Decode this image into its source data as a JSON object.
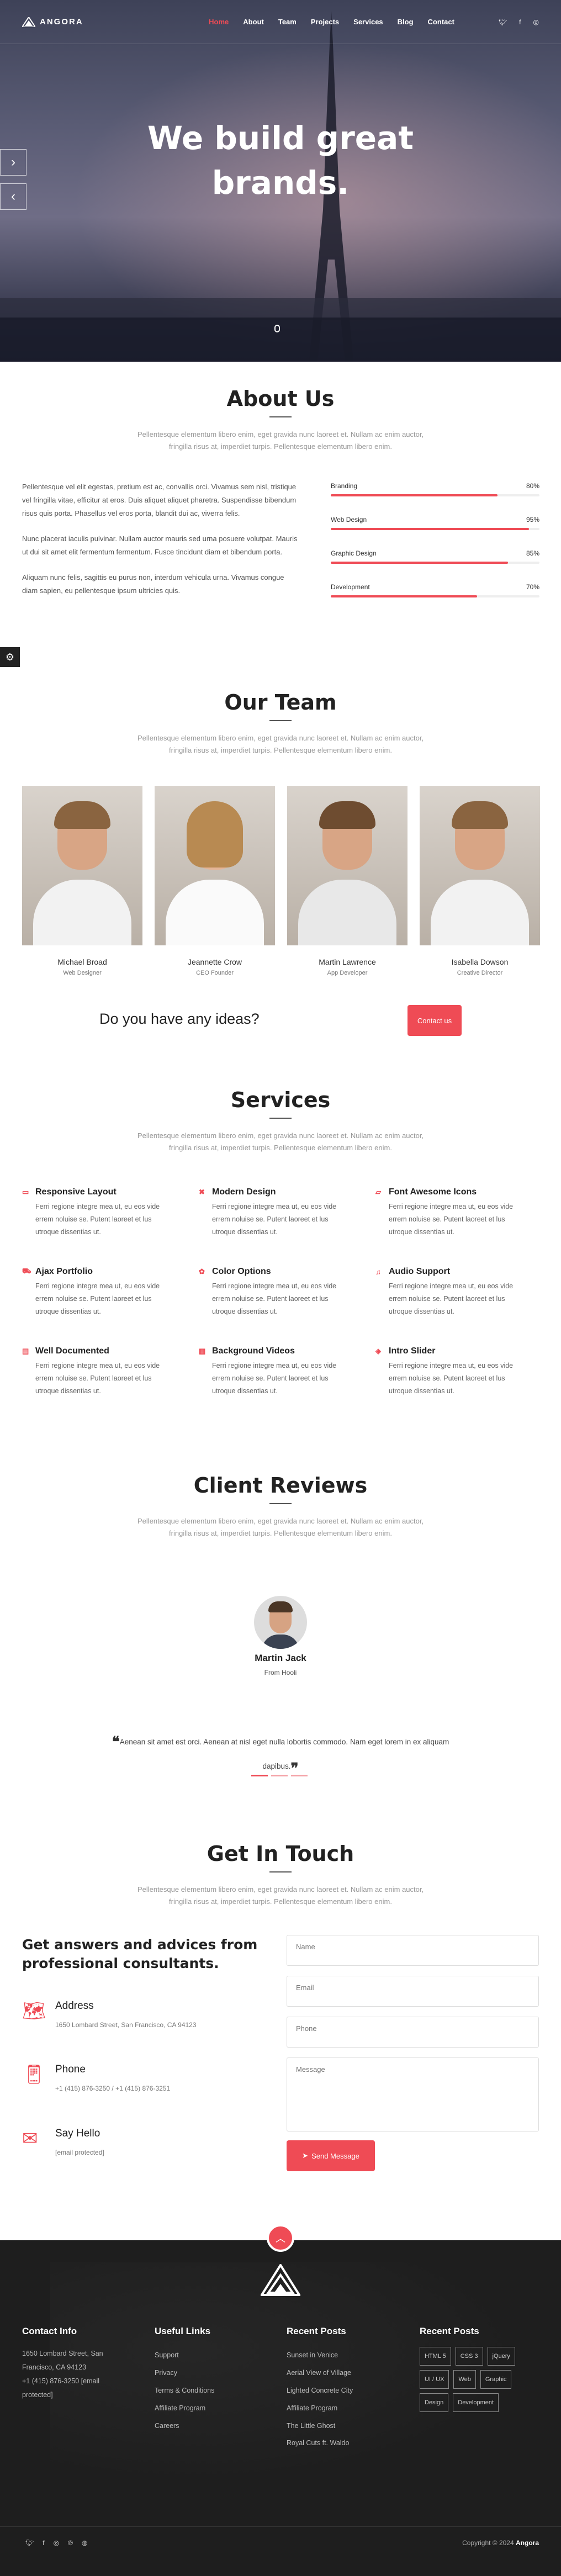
{
  "brand": {
    "name": "ANGORA"
  },
  "nav": {
    "items": [
      "Home",
      "About",
      "Team",
      "Projects",
      "Services",
      "Blog",
      "Contact"
    ],
    "active": "Home",
    "social": [
      "twitter-icon",
      "facebook-icon",
      "instagram-icon"
    ]
  },
  "hero": {
    "line1": "We build great",
    "line2": "brands."
  },
  "about": {
    "title": "About Us",
    "subtitle": "Pellentesque elementum libero enim, eget gravida nunc laoreet et. Nullam ac enim auctor, fringilla risus at, imperdiet turpis. Pellentesque elementum libero enim.",
    "p1": "Pellentesque vel elit egestas, pretium est ac, convallis orci. Vivamus sem nisl, tristique vel fringilla vitae, efficitur at eros. Duis aliquet aliquet pharetra. Suspendisse bibendum risus quis porta. Phasellus vel eros porta, blandit dui ac, viverra felis.",
    "p2": "Nunc placerat iaculis pulvinar. Nullam auctor mauris sed urna posuere volutpat. Mauris ut dui sit amet elit fermentum fermentum. Fusce tincidunt diam et bibendum porta.",
    "p3": "Aliquam nunc felis, sagittis eu purus non, interdum vehicula urna. Vivamus congue diam sapien, eu pellentesque ipsum ultricies quis.",
    "skills": [
      {
        "name": "Branding",
        "value": "80%",
        "level": 0.8
      },
      {
        "name": "Web Design",
        "value": "95%",
        "level": 0.95
      },
      {
        "name": "Graphic Design",
        "value": "85%",
        "level": 0.85
      },
      {
        "name": "Development",
        "value": "70%",
        "level": 0.7
      }
    ]
  },
  "team": {
    "title": "Our Team",
    "subtitle": "Pellentesque elementum libero enim, eget gravida nunc laoreet et. Nullam ac enim auctor, fringilla risus at, imperdiet turpis. Pellentesque elementum libero enim.",
    "members": [
      {
        "name": "Michael Broad",
        "role": "Web Designer"
      },
      {
        "name": "Jeannette Crow",
        "role": "CEO Founder"
      },
      {
        "name": "Martin Lawrence",
        "role": "App Developer"
      },
      {
        "name": "Isabella Dowson",
        "role": "Creative Director"
      }
    ]
  },
  "cta": {
    "text": "Do you have any ideas?",
    "button": "Contact us"
  },
  "services": {
    "title": "Services",
    "subtitle": "Pellentesque elementum libero enim, eget gravida nunc laoreet et. Nullam ac enim auctor, fringilla risus at, imperdiet turpis. Pellentesque elementum libero enim.",
    "description": "Ferri regione integre mea ut, eu eos vide errem noluise se. Putent laoreet et lus utroque dissentias ut.",
    "items": [
      {
        "title": "Responsive Layout",
        "icon": "laptop-icon"
      },
      {
        "title": "Modern Design",
        "icon": "cross-icon"
      },
      {
        "title": "Font Awesome Icons",
        "icon": "folder-icon"
      },
      {
        "title": "Ajax Portfolio",
        "icon": "car-icon"
      },
      {
        "title": "Color Options",
        "icon": "palette-icon"
      },
      {
        "title": "Audio Support",
        "icon": "headphones-icon"
      },
      {
        "title": "Well Documented",
        "icon": "book-icon"
      },
      {
        "title": "Background Videos",
        "icon": "film-icon"
      },
      {
        "title": "Intro Slider",
        "icon": "slider-icon"
      }
    ]
  },
  "reviews": {
    "title": "Client Reviews",
    "subtitle": "Pellentesque elementum libero enim, eget gravida nunc laoreet et. Nullam ac enim auctor, fringilla risus at, imperdiet turpis. Pellentesque elementum libero enim.",
    "name": "Martin Jack",
    "from": "From Hooli",
    "quote": "Aenean sit amet est orci. Aenean at nisl eget nulla lobortis commodo. Nam eget lorem in ex aliquam dapibus."
  },
  "contact": {
    "title": "Get In Touch",
    "subtitle": "Pellentesque elementum libero enim, eget gravida nunc laoreet et. Nullam ac enim auctor, fringilla risus at, imperdiet turpis. Pellentesque elementum libero enim.",
    "heading": "Get answers and advices from professional consultants.",
    "address_label": "Address",
    "address": "1650 Lombard Street, San Francisco, CA 94123",
    "phone_label": "Phone",
    "phone": "+1 (415) 876-3250 / +1 (415) 876-3251",
    "email_label": "Say Hello",
    "email": "[email protected]",
    "name_ph": "Name",
    "email_ph": "Email",
    "phone_ph": "Phone",
    "message_ph": "Message",
    "send": "Send Message"
  },
  "footer": {
    "info_title": "Contact Info",
    "info_address": "1650 Lombard Street, San Francisco, CA 94123",
    "info_phone": "+1 (415) 876-3250",
    "info_email": "[email protected]",
    "links_title": "Useful Links",
    "links": [
      "Support",
      "Privacy",
      "Terms & Conditions",
      "Affiliate Program",
      "Careers"
    ],
    "posts_title": "Recent Posts",
    "posts": [
      "Sunset in Venice",
      "Aerial View of Village",
      "Lighted Concrete City",
      "Affiliate Program",
      "The Little Ghost",
      "Royal Cuts ft. Waldo"
    ],
    "tags_title": "Recent Posts",
    "tags": [
      "HTML 5",
      "CSS 3",
      "jQuery",
      "UI / UX",
      "Web",
      "Graphic",
      "Design",
      "Development"
    ],
    "copyright": "Copyright © 2024",
    "copyright_brand": "Angora",
    "social": [
      "twitter-icon",
      "facebook-icon",
      "instagram-icon",
      "pinterest-icon",
      "dribbble-icon"
    ]
  }
}
